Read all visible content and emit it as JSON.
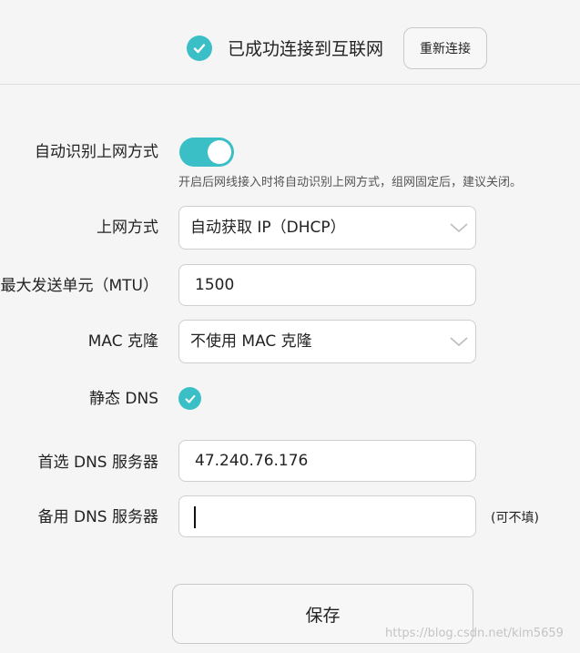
{
  "status": {
    "text": "已成功连接到互联网",
    "reconnect_label": "重新连接"
  },
  "auto_detect": {
    "label": "自动识别上网方式",
    "enabled": true,
    "hint": "开启后网线接入时将自动识别上网方式，组网固定后，建议关闭。"
  },
  "connection_type": {
    "label": "上网方式",
    "value": "自动获取 IP（DHCP）"
  },
  "mtu": {
    "label": "最大发送单元（MTU）",
    "value": "1500"
  },
  "mac_clone": {
    "label": "MAC 克隆",
    "value": "不使用 MAC 克隆"
  },
  "static_dns": {
    "label": "静态 DNS",
    "checked": true
  },
  "primary_dns": {
    "label": "首选 DNS 服务器",
    "value": "47.240.76.176"
  },
  "secondary_dns": {
    "label": "备用 DNS 服务器",
    "value": "",
    "note": "(可不填)"
  },
  "save_label": "保存",
  "watermark": "https://blog.csdn.net/kim5659",
  "colors": {
    "accent": "#3bbfc6",
    "background": "#f5f5f5"
  },
  "icons": {
    "status": "check-circle-icon",
    "select": "chevron-down-icon"
  }
}
